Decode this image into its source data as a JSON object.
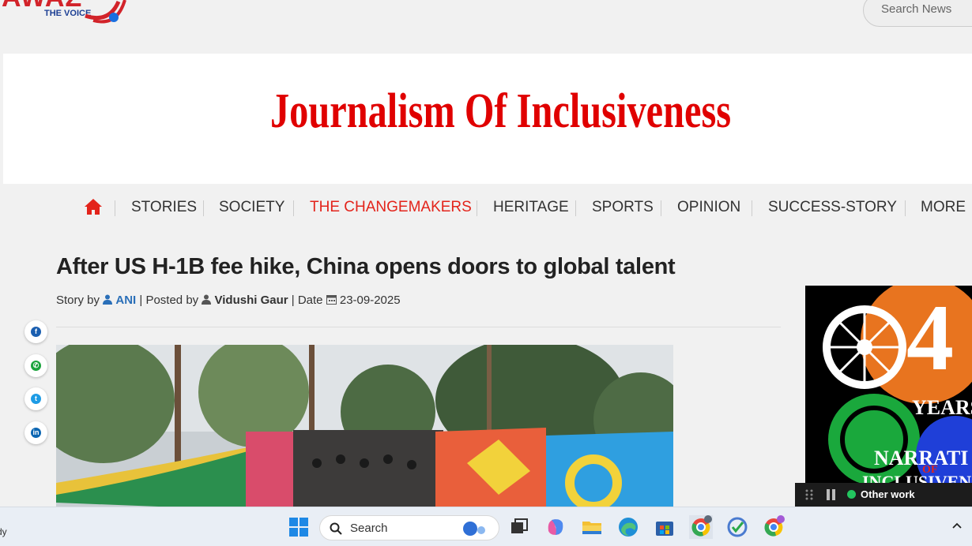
{
  "header": {
    "logo_main": "AWAZ",
    "logo_sub": "THE VOICE",
    "search_placeholder": "Search News"
  },
  "banner": {
    "text": "Journalism Of Inclusiveness"
  },
  "nav": {
    "items": [
      "STORIES",
      "SOCIETY",
      "THE CHANGEMAKERS",
      "HERITAGE",
      "SPORTS",
      "OPINION",
      "SUCCESS-STORY",
      "MORE"
    ],
    "active": "THE CHANGEMAKERS"
  },
  "article": {
    "title": "After US H-1B fee hike, China opens doors to global talent",
    "story_by_label": "Story by",
    "author": "ANI",
    "posted_by_label": "| Posted by",
    "poster": "Vidushi Gaur",
    "date_label": "| Date",
    "date": "23-09-2025"
  },
  "share": [
    "facebook-icon",
    "whatsapp-icon",
    "twitter-icon",
    "linkedin-icon"
  ],
  "ad": {
    "text1": "4",
    "text2": "YEARS",
    "text3": "NARRATI",
    "text4": "OF",
    "text5": "INCLUSIVEN"
  },
  "media_widget": {
    "label": "Other work"
  },
  "taskbar": {
    "search_label": "Search",
    "left_text": "dy"
  },
  "colors": {
    "brand_red": "#e3241b",
    "link_blue": "#2a6fb8",
    "banner_red": "#e00000"
  }
}
